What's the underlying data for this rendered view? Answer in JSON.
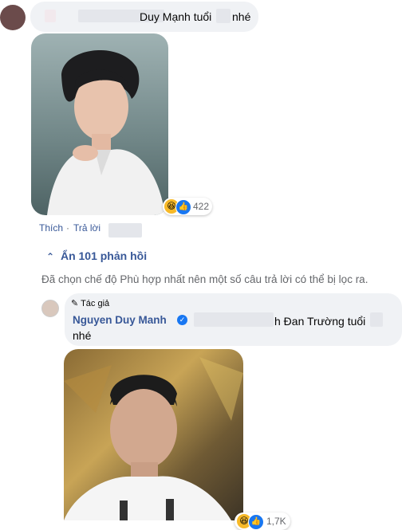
{
  "comment1": {
    "text_visible": "Duy Mạnh tuổi",
    "text_end": "nhé"
  },
  "reactions1": {
    "count": "422",
    "icons": [
      "haha-icon",
      "like-icon"
    ]
  },
  "actions1": {
    "like": "Thích",
    "reply": "Trả lời"
  },
  "replies_toggle": {
    "label": "Ẩn 101 phản hồi"
  },
  "filter_notice": {
    "text": "Đã chọn chế độ Phù hợp nhất nên một số câu trả lời có thể bị lọc ra."
  },
  "reply1": {
    "badge": "Tác giả",
    "author": "Nguyen Duy Manh",
    "text_visible": "h Đan Trường tuổi",
    "text_end": "nhé"
  },
  "reactions2": {
    "count": "1,7K"
  },
  "colors": {
    "bubble": "#f0f2f5",
    "link": "#385898",
    "verified": "#1877f2"
  }
}
